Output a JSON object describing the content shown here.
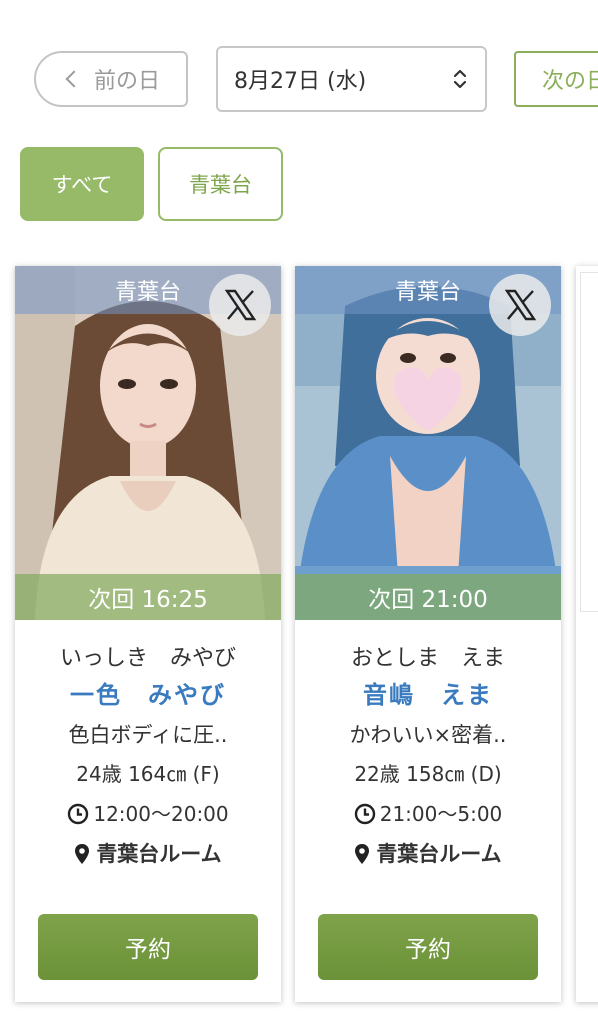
{
  "nav": {
    "prev_label": "前の日",
    "date_value": "8月27日 (水)",
    "next_label": "次の日"
  },
  "filters": {
    "all_label": "すべて",
    "area_label": "青葉台"
  },
  "cards": [
    {
      "area": "青葉台",
      "next_label": "次回 16:25",
      "kana": "いっしき　みやび",
      "name": "一色　みやび",
      "catch": "色白ボディに圧..",
      "spec": "24歳 164㎝ (F)",
      "hours": "12:00〜20:00",
      "room": "青葉台ルーム",
      "reserve_label": "予約",
      "social_icon": "x-logo-icon"
    },
    {
      "area": "青葉台",
      "next_label": "次回 21:00",
      "kana": "おとしま　えま",
      "name": "音嶋　えま",
      "catch": "かわいい×密着..",
      "spec": "22歳 158㎝ (D)",
      "hours": "21:00〜5:00",
      "room": "青葉台ルーム",
      "reserve_label": "予約",
      "social_icon": "x-logo-icon"
    }
  ],
  "colors": {
    "accent_green": "#96ba68",
    "button_green": "#6f9a3c",
    "name_blue": "#3a7bbf"
  }
}
